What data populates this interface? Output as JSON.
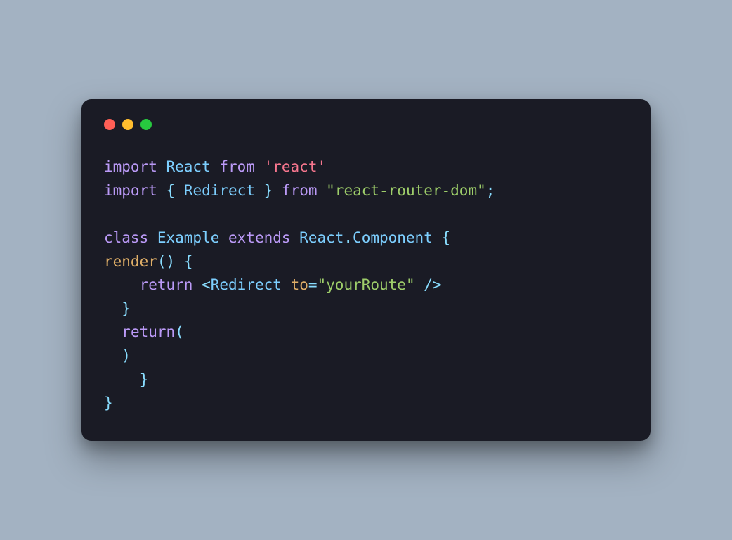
{
  "window": {
    "buttons": {
      "close": "close",
      "minimize": "minimize",
      "maximize": "maximize"
    }
  },
  "code": {
    "line1": {
      "t1": "import",
      "t2": " React ",
      "t3": "from",
      "t4": " ",
      "t5": "'react'"
    },
    "line2": {
      "t1": "import",
      "t2": " ",
      "t3": "{",
      "t4": " Redirect ",
      "t5": "}",
      "t6": " ",
      "t7": "from",
      "t8": " ",
      "t9": "\"react-router-dom\"",
      "t10": ";"
    },
    "line3": "",
    "line4": {
      "t1": "class",
      "t2": " Example ",
      "t3": "extends",
      "t4": " React",
      "t5": ".",
      "t6": "Component",
      "t7": " ",
      "t8": "{"
    },
    "line5": {
      "t1": "render",
      "t2": "(",
      "t3": ")",
      "t4": " ",
      "t5": "{"
    },
    "line6": {
      "t1": "    ",
      "t2": "return",
      "t3": " ",
      "t4": "<",
      "t5": "Redirect",
      "t6": " ",
      "t7": "to",
      "t8": "=",
      "t9": "\"yourRoute\"",
      "t10": " ",
      "t11": "/>"
    },
    "line7": {
      "t1": "  ",
      "t2": "}"
    },
    "line8": {
      "t1": "  ",
      "t2": "return",
      "t3": "("
    },
    "line9": {
      "t1": "  ",
      "t2": ")"
    },
    "line10": {
      "t1": "    ",
      "t2": "}"
    },
    "line11": {
      "t1": "}"
    }
  }
}
